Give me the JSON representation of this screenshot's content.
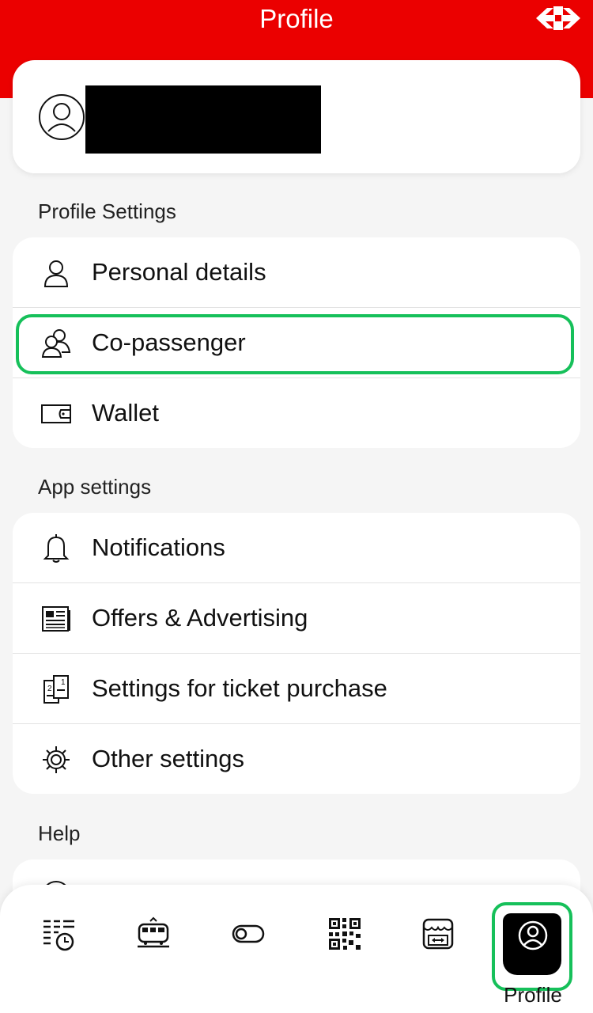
{
  "header": {
    "title": "Profile",
    "logo_icon": "sbb-arrows-logo",
    "color": "#eb0000"
  },
  "profile_card": {
    "avatar_icon": "user-circle-icon"
  },
  "sections": {
    "profile_settings": {
      "label": "Profile Settings",
      "items": [
        {
          "label": "Personal details",
          "icon": "person-icon"
        },
        {
          "label": "Co-passenger",
          "icon": "co-passenger-icon"
        },
        {
          "label": "Wallet",
          "icon": "wallet-icon"
        }
      ]
    },
    "app_settings": {
      "label": "App settings",
      "items": [
        {
          "label": "Notifications",
          "icon": "bell-icon"
        },
        {
          "label": "Offers & Advertising",
          "icon": "newspaper-icon"
        },
        {
          "label": "Settings for ticket purchase",
          "icon": "ticket-settings-icon"
        },
        {
          "label": "Other settings",
          "icon": "gear-icon"
        }
      ]
    },
    "help": {
      "label": "Help"
    }
  },
  "tabbar": {
    "tabs": [
      {
        "icon": "timetable-icon"
      },
      {
        "icon": "train-icon"
      },
      {
        "icon": "toggle-icon"
      },
      {
        "icon": "qr-code-icon"
      },
      {
        "icon": "shop-icon"
      },
      {
        "icon": "profile-icon",
        "label": "Profile",
        "active": true
      }
    ]
  },
  "colors": {
    "highlight": "#16c05a",
    "brand_red": "#eb0000"
  }
}
